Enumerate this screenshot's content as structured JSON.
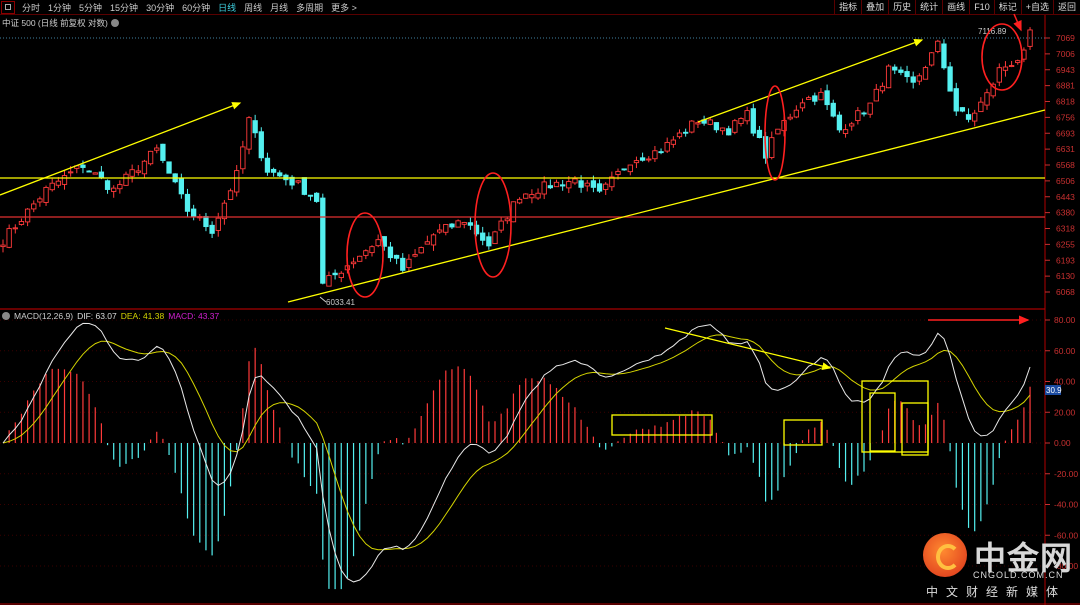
{
  "toolbar": {
    "periods": [
      "分时",
      "1分钟",
      "5分钟",
      "15分钟",
      "30分钟",
      "60分钟",
      "日线",
      "周线",
      "月线",
      "多周期",
      "更多 >"
    ],
    "active_period": "日线",
    "right_buttons": [
      "指标",
      "叠加",
      "历史",
      "统计",
      "画线",
      "F10",
      "标记",
      "+自选",
      "返回"
    ]
  },
  "subtitle": "中证 500 (日线 前复权 对数)",
  "macd_legend": {
    "name": "MACD(12,26,9)",
    "dif": "DIF: 63.07",
    "dea": "DEA: 41.38",
    "macd": "MACD: 43.37"
  },
  "colors": {
    "up": "#ff3a3a",
    "down": "#54f0f0",
    "dif": "#e8e8e8",
    "dea": "#d4d400",
    "axis": "#c83030",
    "annot_yellow": "#ffff00",
    "annot_red": "#ff2020"
  },
  "price_axis": [
    "7069",
    "7006",
    "6943",
    "6881",
    "6818",
    "6756",
    "6693",
    "6631",
    "6568",
    "6506",
    "6443",
    "6380",
    "6318",
    "6255",
    "6193",
    "6130",
    "6068"
  ],
  "macd_axis": [
    "80.00",
    "60.00",
    "40.00",
    "20.00",
    "0.00",
    "-20.00",
    "-40.00",
    "-60.00",
    "-80.00"
  ],
  "macd_current_tag": "30.9",
  "low_label": "6033.41",
  "high_label": "7116.89",
  "watermark": {
    "cn": "中金网",
    "en": "CNGOLD.COM.CN",
    "sub": "中文财经新媒体"
  },
  "chart_data": {
    "type": "candlestick",
    "bars": 168,
    "ylim": [
      6040,
      7100
    ],
    "close_keypoints": [
      [
        0,
        6273
      ],
      [
        7,
        6470
      ],
      [
        13,
        6569
      ],
      [
        18,
        6470
      ],
      [
        25,
        6628
      ],
      [
        30,
        6391
      ],
      [
        34,
        6313
      ],
      [
        38,
        6529
      ],
      [
        40,
        6746
      ],
      [
        43,
        6549
      ],
      [
        48,
        6490
      ],
      [
        51,
        6431
      ],
      [
        52,
        6096
      ],
      [
        56,
        6175
      ],
      [
        61,
        6273
      ],
      [
        65,
        6155
      ],
      [
        70,
        6293
      ],
      [
        75,
        6352
      ],
      [
        79,
        6254
      ],
      [
        84,
        6450
      ],
      [
        89,
        6490
      ],
      [
        93,
        6510
      ],
      [
        97,
        6450
      ],
      [
        102,
        6588
      ],
      [
        107,
        6628
      ],
      [
        113,
        6746
      ],
      [
        118,
        6707
      ],
      [
        121,
        6766
      ],
      [
        124,
        6608
      ],
      [
        126,
        6707
      ],
      [
        130,
        6825
      ],
      [
        133,
        6844
      ],
      [
        136,
        6707
      ],
      [
        141,
        6805
      ],
      [
        144,
        6943
      ],
      [
        148,
        6884
      ],
      [
        152,
        7041
      ],
      [
        155,
        6785
      ],
      [
        157,
        6746
      ],
      [
        160,
        6844
      ],
      [
        162,
        6943
      ],
      [
        166,
        7002
      ],
      [
        167,
        7081
      ]
    ],
    "macd_ylim": [
      -80,
      80
    ]
  }
}
